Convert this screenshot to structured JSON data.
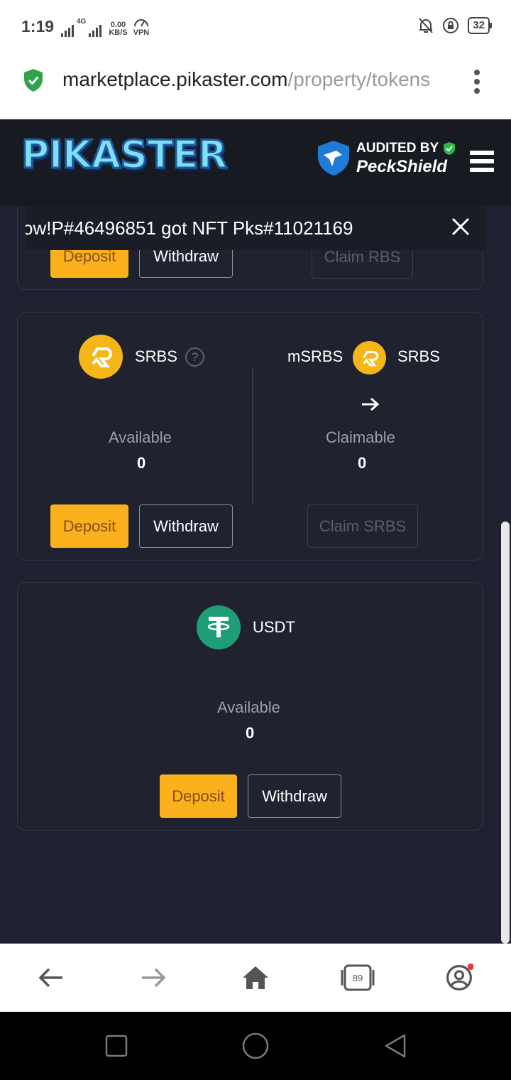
{
  "status_bar": {
    "time": "1:19",
    "network_type": "4G",
    "speed_value": "0.00",
    "speed_unit": "KB/S",
    "vpn": "VPN",
    "battery": "32"
  },
  "browser": {
    "url_domain": "marketplace.pikaster.com",
    "url_path": "/property/tokens",
    "tab_count": "89"
  },
  "header": {
    "logo_text": "PIKASTER",
    "audit_line1": "AUDITED BY",
    "audit_line2": "PeckShield"
  },
  "toast": {
    "message": "ow!P#46496851 got NFT Pks#11021169"
  },
  "rbs_card": {
    "deposit_label": "Deposit",
    "withdraw_label": "Withdraw",
    "claim_label": "Claim RBS"
  },
  "srbs_card": {
    "token_name": "SRBS",
    "help_symbol": "?",
    "conv_from": "mSRBS",
    "conv_to": "SRBS",
    "arrow": "→",
    "available_label": "Available",
    "available_value": "0",
    "claimable_label": "Claimable",
    "claimable_value": "0",
    "deposit_label": "Deposit",
    "withdraw_label": "Withdraw",
    "claim_label": "Claim SRBS"
  },
  "usdt_card": {
    "token_name": "USDT",
    "available_label": "Available",
    "available_value": "0",
    "deposit_label": "Deposit",
    "withdraw_label": "Withdraw"
  },
  "colors": {
    "accent": "#fbb11c",
    "background": "#1f2130",
    "usdt_green": "#1e9e76",
    "secure_green": "#2fa24a"
  },
  "icons": [
    "shield-check-icon",
    "menu-dots-icon",
    "hamburger-icon",
    "srbs-coin-icon",
    "usdt-coin-icon",
    "help-icon",
    "arrow-right-icon",
    "close-icon",
    "back-icon",
    "forward-icon",
    "home-icon",
    "tabs-icon",
    "profile-icon"
  ]
}
